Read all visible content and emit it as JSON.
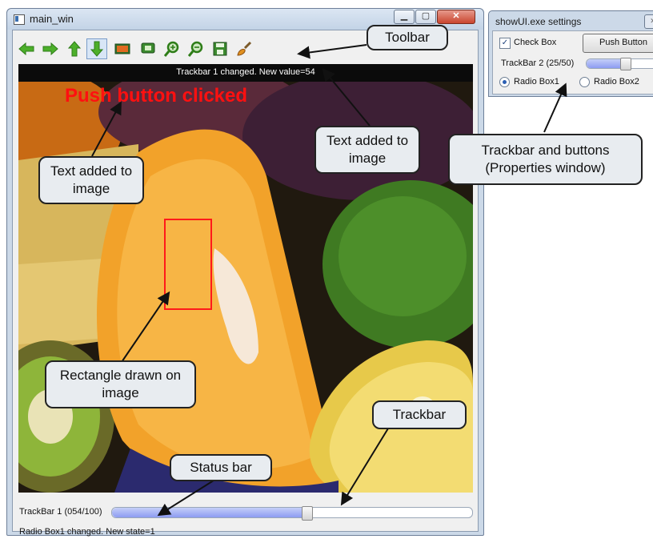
{
  "main_window": {
    "title": "main_win",
    "controls": {
      "minimize": "▁",
      "maximize": "▢",
      "close": "✕"
    },
    "toolbar_icons": [
      "arrow-left-icon",
      "arrow-right-icon",
      "arrow-up-icon",
      "arrow-down-icon",
      "image-icon",
      "zoom-fit-icon",
      "zoom-in-icon",
      "zoom-out-icon",
      "save-icon",
      "brush-icon"
    ],
    "image": {
      "top_text": "Trackbar 1 changed. New value=54",
      "push_text": "Push button clicked"
    },
    "trackbar": {
      "label": "TrackBar 1 (054/100)",
      "value": 54,
      "max": 100
    },
    "status": "Radio Box1 changed. New state=1"
  },
  "settings_window": {
    "title": "showUI.exe settings",
    "checkbox_label": "Check Box",
    "checkbox_checked": true,
    "push_button": "Push Button",
    "trackbar_label": "TrackBar 2 (25/50)",
    "trackbar_value": 25,
    "trackbar_max": 50,
    "radio1": "Radio Box1",
    "radio2": "Radio Box2",
    "radio_selected": 1
  },
  "callouts": {
    "toolbar": "Toolbar",
    "text_added_left": "Text added to image",
    "text_added_right": "Text added to image",
    "trackbar_buttons": "Trackbar and buttons (Properties window)",
    "rectangle": "Rectangle drawn on image",
    "trackbar": "Trackbar",
    "status_bar": "Status bar"
  },
  "colors": {
    "accent_red": "#ff1010",
    "slider_fill": "#8d9cf2",
    "toolbar_green": "#4caf2a"
  }
}
